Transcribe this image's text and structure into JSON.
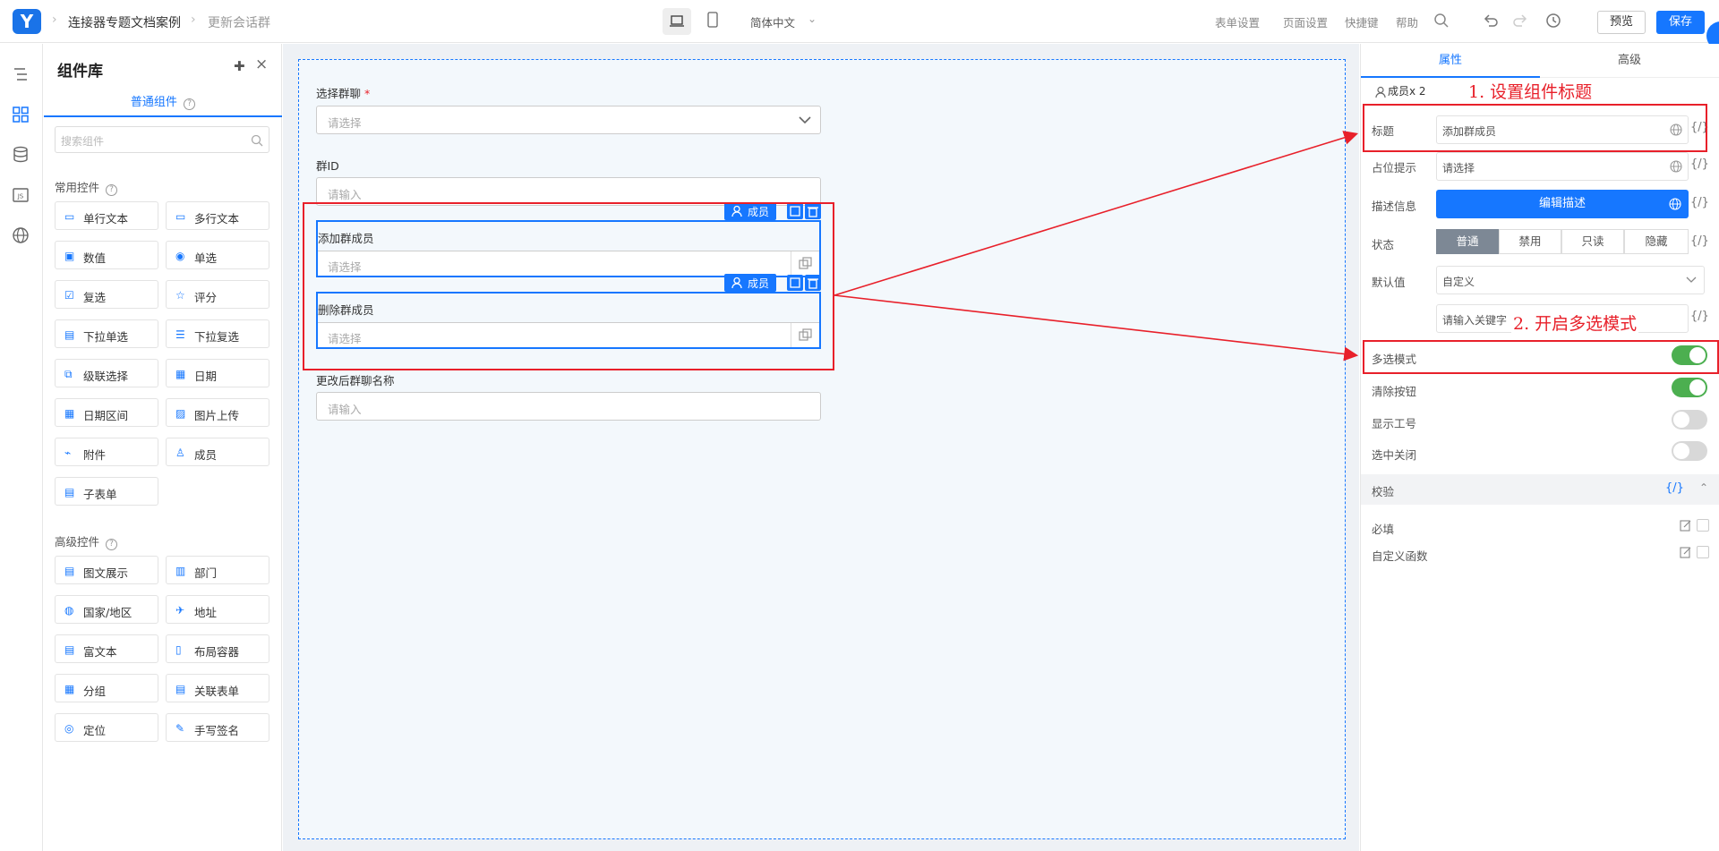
{
  "topbar": {
    "breadcrumb": [
      "连接器专题文档案例",
      "更新会话群"
    ],
    "language": "简体中文",
    "links": [
      "表单设置",
      "页面设置",
      "快捷键",
      "帮助"
    ],
    "preview": "预览",
    "save": "保存"
  },
  "components": {
    "title": "组件库",
    "tab": "普通组件",
    "search_placeholder": "搜索组件",
    "common_section": "常用控件",
    "common": [
      {
        "label": "单行文本",
        "icon": "single-line-text-icon"
      },
      {
        "label": "多行文本",
        "icon": "multi-line-text-icon"
      },
      {
        "label": "数值",
        "icon": "number-icon"
      },
      {
        "label": "单选",
        "icon": "radio-icon"
      },
      {
        "label": "复选",
        "icon": "checkbox-icon"
      },
      {
        "label": "评分",
        "icon": "star-icon"
      },
      {
        "label": "下拉单选",
        "icon": "dropdown-icon"
      },
      {
        "label": "下拉复选",
        "icon": "dropdown-multi-icon"
      },
      {
        "label": "级联选择",
        "icon": "cascade-icon"
      },
      {
        "label": "日期",
        "icon": "calendar-icon"
      },
      {
        "label": "日期区间",
        "icon": "date-range-icon"
      },
      {
        "label": "图片上传",
        "icon": "image-upload-icon"
      },
      {
        "label": "附件",
        "icon": "paperclip-icon"
      },
      {
        "label": "成员",
        "icon": "member-icon"
      },
      {
        "label": "子表单",
        "icon": "subform-icon"
      }
    ],
    "advanced_section": "高级控件",
    "advanced": [
      {
        "label": "图文展示",
        "icon": "image-text-icon"
      },
      {
        "label": "部门",
        "icon": "department-icon"
      },
      {
        "label": "国家/地区",
        "icon": "globe-icon"
      },
      {
        "label": "地址",
        "icon": "address-icon"
      },
      {
        "label": "富文本",
        "icon": "rich-text-icon"
      },
      {
        "label": "布局容器",
        "icon": "layout-icon"
      },
      {
        "label": "分组",
        "icon": "group-icon"
      },
      {
        "label": "关联表单",
        "icon": "link-form-icon"
      },
      {
        "label": "定位",
        "icon": "location-icon"
      },
      {
        "label": "手写签名",
        "icon": "signature-icon"
      }
    ]
  },
  "canvas": {
    "fields": [
      {
        "label": "选择群聊",
        "required_mark": "*",
        "placeholder": "请选择"
      },
      {
        "label": "群ID",
        "placeholder": "请输入"
      },
      {
        "label": "添加群成员",
        "placeholder": "请选择",
        "tag": "成员"
      },
      {
        "label": "删除群成员",
        "placeholder": "请选择",
        "tag": "成员"
      },
      {
        "label": "更改后群聊名称",
        "placeholder": "请输入"
      }
    ]
  },
  "props": {
    "tabs": [
      "属性",
      "高级"
    ],
    "count": "成员x 2",
    "rows": {
      "title_label": "标题",
      "title_value": "添加群成员",
      "placeholder_label": "占位提示",
      "placeholder_value": "请选择",
      "desc_label": "描述信息",
      "desc_button": "编辑描述",
      "state_label": "状态",
      "states": [
        "普通",
        "禁用",
        "只读",
        "隐藏"
      ],
      "default_label": "默认值",
      "default_value": "自定义",
      "keyword_placeholder": "请输入关键字",
      "multi_label": "多选模式",
      "clear_label": "清除按钮",
      "jobno_label": "显示工号",
      "close_label": "选中关闭",
      "validate_label": "校验",
      "required_label": "必填",
      "func_label": "自定义函数"
    },
    "brace": "{/}"
  },
  "annotations": {
    "a1": "1. 设置组件标题",
    "a2": "2. 开启多选模式"
  },
  "colors": {
    "primary": "#1677ff",
    "annotation": "#e8202a",
    "toggle_on": "#4caf50"
  }
}
